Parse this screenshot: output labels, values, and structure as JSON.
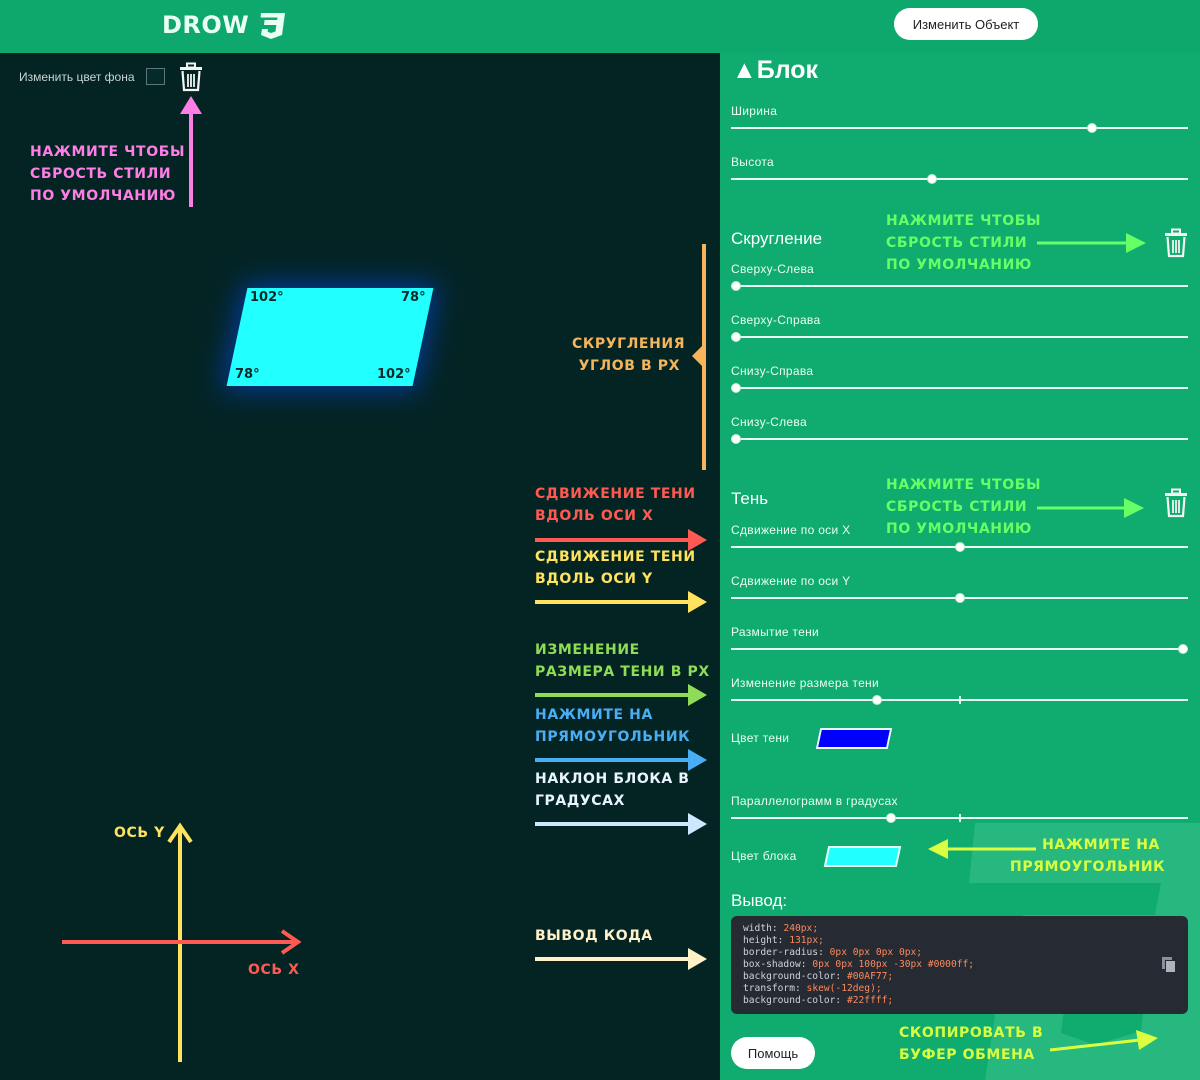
{
  "header": {
    "logo_text": "DROW",
    "logo_icon": "css3-icon",
    "change_object_label": "Изменить Объект"
  },
  "canvas": {
    "bg_label": "Изменить цвет фона",
    "angles": [
      "102°",
      "78°",
      "78°",
      "102°"
    ],
    "block_color": "#22ffff"
  },
  "annotations": {
    "reset_left": [
      "НАЖМИТЕ ЧТОБЫ",
      "СБРОСТЬ СТИЛИ",
      "ПО УМОЛЧАНИЮ"
    ],
    "radius": [
      "СКРУГЛЕНИЯ",
      "УГЛОВ В PX"
    ],
    "reset_radius": [
      "НАЖМИТЕ ЧТОБЫ",
      "СБРОСТЬ СТИЛИ",
      "ПО УМОЛЧАНИЮ"
    ],
    "reset_shadow": [
      "НАЖМИТЕ ЧТОБЫ",
      "СБРОСТЬ СТИЛИ",
      "ПО УМОЛЧАНИЮ"
    ],
    "shadow_x": [
      "СДВИЖЕНИЕ ТЕНИ",
      "ВДОЛЬ ОСИ Х"
    ],
    "shadow_y": [
      "СДВИЖЕНИЕ ТЕНИ",
      "ВДОЛЬ ОСИ Y"
    ],
    "shadow_size": [
      "ИЗМЕНЕНИЕ",
      "РАЗМЕРА ТЕНИ В PX"
    ],
    "click_rect": [
      "НАЖМИТЕ НА",
      "ПРЯМОУГОЛЬНИК"
    ],
    "skew": [
      "НАКЛОН БЛОКА В",
      "ГРАДУСАХ"
    ],
    "code_out": [
      "ВЫВОД КОДА"
    ],
    "click_rect_right": [
      "НАЖМИТЕ НА",
      "ПРЯМОУГОЛЬНИК"
    ],
    "copy": [
      "СКОПИРОВАТЬ В",
      "БУФЕР ОБМЕНА"
    ],
    "axis_y": "ОСЬ Y",
    "axis_x": "ОСЬ Х"
  },
  "panel": {
    "title": "▲Блок",
    "width_label": "Ширина",
    "width_value": 0.79,
    "height_label": "Высота",
    "height_value": 0.44,
    "radius_title": "Скругление",
    "radius": [
      {
        "label": "Сверху-Слева",
        "value": 0.01
      },
      {
        "label": "Сверху-Справа",
        "value": 0.01
      },
      {
        "label": "Снизу-Справа",
        "value": 0.01
      },
      {
        "label": "Снизу-Слева",
        "value": 0.01
      }
    ],
    "shadow_title": "Тень",
    "shadow_x_label": "Сдвижение по оси X",
    "shadow_x_value": 0.5,
    "shadow_y_label": "Сдвижение по оси Y",
    "shadow_y_value": 0.5,
    "blur_label": "Размытие тени",
    "blur_value": 0.99,
    "spread_label": "Изменение размера тени",
    "spread_value": 0.32,
    "shadow_color_label": "Цвет тени",
    "shadow_color": "#0000ff",
    "skew_label": "Параллелограмм в градусах",
    "skew_value": 0.35,
    "block_color_label": "Цвет блока",
    "block_color": "#22ffff"
  },
  "output": {
    "label": "Вывод:",
    "lines": [
      {
        "prop": "width:",
        "val": "240px;"
      },
      {
        "prop": "height:",
        "val": "131px;"
      },
      {
        "prop": "border-radius:",
        "val": "0px 0px 0px 0px;"
      },
      {
        "prop": "box-shadow:",
        "val": "0px 0px 100px -30px #0000ff;"
      },
      {
        "prop": "background-color:",
        "val": "#00AF77;"
      },
      {
        "prop": "transform:",
        "val": "skew(-12deg);"
      },
      {
        "prop": "background-color:",
        "val": "#22ffff;"
      }
    ],
    "help_label": "Помощь"
  }
}
